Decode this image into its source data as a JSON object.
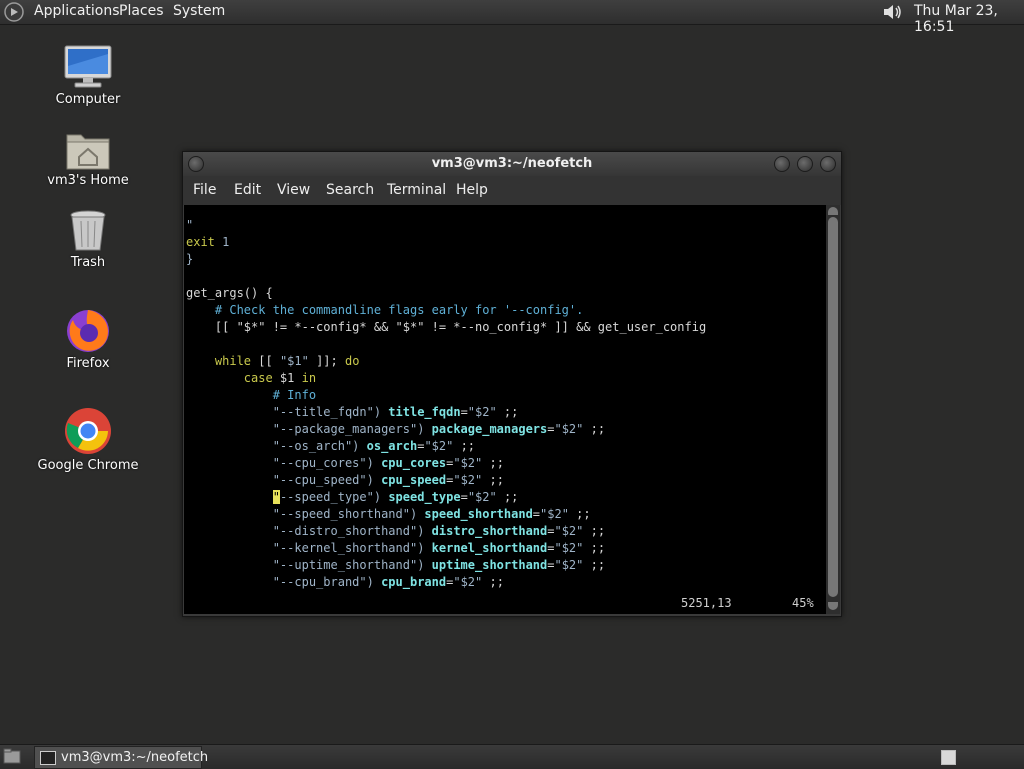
{
  "top_panel": {
    "menus": [
      "Applications",
      "Places",
      "System"
    ],
    "clock": "Thu Mar 23, 16:51"
  },
  "desktop_icons": [
    {
      "label": "Computer",
      "icon": "computer-icon"
    },
    {
      "label": "vm3's Home",
      "icon": "home-folder-icon"
    },
    {
      "label": "Trash",
      "icon": "trash-icon"
    },
    {
      "label": "Firefox",
      "icon": "firefox-icon"
    },
    {
      "label": "Google Chrome",
      "icon": "chrome-icon"
    }
  ],
  "terminal": {
    "title": "vm3@vm3:~/neofetch",
    "menus": [
      "File",
      "Edit",
      "View",
      "Search",
      "Terminal",
      "Help"
    ],
    "lines": [
      [
        {
          "t": "\"",
          "c": "c-str"
        }
      ],
      [
        {
          "t": "exit ",
          "c": "c-kw"
        },
        {
          "t": "1",
          "c": "c-str"
        }
      ],
      [
        {
          "t": "}",
          "c": "c-str"
        }
      ],
      [],
      [
        {
          "t": "get_args() {",
          "c": "c-norm"
        }
      ],
      [
        {
          "t": "    # Check the commandline flags early for '--config'.",
          "c": "c-com"
        }
      ],
      [
        {
          "t": "    [[ \"$*\" != *--config* && \"$*\" != *--no_config* ]] && get_user_config",
          "c": "c-norm"
        }
      ],
      [],
      [
        {
          "t": "    while ",
          "c": "c-kw"
        },
        {
          "t": "[[ ",
          "c": "c-norm"
        },
        {
          "t": "\"$1\"",
          "c": "c-str"
        },
        {
          "t": " ]]; ",
          "c": "c-norm"
        },
        {
          "t": "do",
          "c": "c-kw"
        }
      ],
      [
        {
          "t": "        case ",
          "c": "c-kw"
        },
        {
          "t": "$1 ",
          "c": "c-norm"
        },
        {
          "t": "in",
          "c": "c-kw"
        }
      ],
      [
        {
          "t": "            # Info",
          "c": "c-com"
        }
      ],
      [
        {
          "t": "            ",
          "c": "c-norm"
        },
        {
          "t": "\"--title_fqdn\")",
          "c": "c-str"
        },
        {
          "t": " title_fqdn",
          "c": "c-var"
        },
        {
          "t": "=",
          "c": "c-norm"
        },
        {
          "t": "\"$2\"",
          "c": "c-str"
        },
        {
          "t": " ;;",
          "c": "c-norm"
        }
      ],
      [
        {
          "t": "            ",
          "c": "c-norm"
        },
        {
          "t": "\"--package_managers\")",
          "c": "c-str"
        },
        {
          "t": " package_managers",
          "c": "c-var"
        },
        {
          "t": "=",
          "c": "c-norm"
        },
        {
          "t": "\"$2\"",
          "c": "c-str"
        },
        {
          "t": " ;;",
          "c": "c-norm"
        }
      ],
      [
        {
          "t": "            ",
          "c": "c-norm"
        },
        {
          "t": "\"--os_arch\")",
          "c": "c-str"
        },
        {
          "t": " os_arch",
          "c": "c-var"
        },
        {
          "t": "=",
          "c": "c-norm"
        },
        {
          "t": "\"$2\"",
          "c": "c-str"
        },
        {
          "t": " ;;",
          "c": "c-norm"
        }
      ],
      [
        {
          "t": "            ",
          "c": "c-norm"
        },
        {
          "t": "\"--cpu_cores\")",
          "c": "c-str"
        },
        {
          "t": " cpu_cores",
          "c": "c-var"
        },
        {
          "t": "=",
          "c": "c-norm"
        },
        {
          "t": "\"$2\"",
          "c": "c-str"
        },
        {
          "t": " ;;",
          "c": "c-norm"
        }
      ],
      [
        {
          "t": "            ",
          "c": "c-norm"
        },
        {
          "t": "\"--cpu_speed\")",
          "c": "c-str"
        },
        {
          "t": " cpu_speed",
          "c": "c-var"
        },
        {
          "t": "=",
          "c": "c-norm"
        },
        {
          "t": "\"$2\"",
          "c": "c-str"
        },
        {
          "t": " ;;",
          "c": "c-norm"
        }
      ],
      [
        {
          "t": "            ",
          "c": "c-norm"
        },
        {
          "t": "\"",
          "c": "cursor"
        },
        {
          "t": "--speed_type\")",
          "c": "c-str"
        },
        {
          "t": " speed_type",
          "c": "c-var"
        },
        {
          "t": "=",
          "c": "c-norm"
        },
        {
          "t": "\"$2\"",
          "c": "c-str"
        },
        {
          "t": " ;;",
          "c": "c-norm"
        }
      ],
      [
        {
          "t": "            ",
          "c": "c-norm"
        },
        {
          "t": "\"--speed_shorthand\")",
          "c": "c-str"
        },
        {
          "t": " speed_shorthand",
          "c": "c-var"
        },
        {
          "t": "=",
          "c": "c-norm"
        },
        {
          "t": "\"$2\"",
          "c": "c-str"
        },
        {
          "t": " ;;",
          "c": "c-norm"
        }
      ],
      [
        {
          "t": "            ",
          "c": "c-norm"
        },
        {
          "t": "\"--distro_shorthand\")",
          "c": "c-str"
        },
        {
          "t": " distro_shorthand",
          "c": "c-var"
        },
        {
          "t": "=",
          "c": "c-norm"
        },
        {
          "t": "\"$2\"",
          "c": "c-str"
        },
        {
          "t": " ;;",
          "c": "c-norm"
        }
      ],
      [
        {
          "t": "            ",
          "c": "c-norm"
        },
        {
          "t": "\"--kernel_shorthand\")",
          "c": "c-str"
        },
        {
          "t": " kernel_shorthand",
          "c": "c-var"
        },
        {
          "t": "=",
          "c": "c-norm"
        },
        {
          "t": "\"$2\"",
          "c": "c-str"
        },
        {
          "t": " ;;",
          "c": "c-norm"
        }
      ],
      [
        {
          "t": "            ",
          "c": "c-norm"
        },
        {
          "t": "\"--uptime_shorthand\")",
          "c": "c-str"
        },
        {
          "t": " uptime_shorthand",
          "c": "c-var"
        },
        {
          "t": "=",
          "c": "c-norm"
        },
        {
          "t": "\"$2\"",
          "c": "c-str"
        },
        {
          "t": " ;;",
          "c": "c-norm"
        }
      ],
      [
        {
          "t": "            ",
          "c": "c-norm"
        },
        {
          "t": "\"--cpu_brand\")",
          "c": "c-str"
        },
        {
          "t": " cpu_brand",
          "c": "c-var"
        },
        {
          "t": "=",
          "c": "c-norm"
        },
        {
          "t": "\"$2\"",
          "c": "c-str"
        },
        {
          "t": " ;;",
          "c": "c-norm"
        }
      ]
    ],
    "ruler_position": "5251,13",
    "ruler_percent": "45%"
  },
  "taskbar": {
    "window_label": "vm3@vm3:~/neofetch"
  }
}
